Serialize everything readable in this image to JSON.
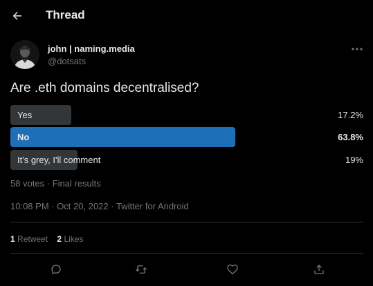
{
  "header": {
    "title": "Thread",
    "back_icon": "arrow-left-icon"
  },
  "tweet": {
    "author": {
      "name": "john | naming.media",
      "handle": "@dotsats"
    },
    "more_icon": "more-horizontal-icon",
    "text": "Are .eth domains decentralised?",
    "poll": {
      "options": [
        {
          "label": "Yes",
          "percent": "17.2%",
          "fraction": 0.172,
          "winner": false
        },
        {
          "label": "No",
          "percent": "63.8%",
          "fraction": 0.638,
          "winner": true
        },
        {
          "label": "It's grey, I'll comment",
          "percent": "19%",
          "fraction": 0.19,
          "winner": false
        }
      ],
      "meta": "58 votes · Final results"
    },
    "timestamp": "10:08 PM · Oct 20, 2022 · Twitter for Android",
    "stats": {
      "retweets_count": "1",
      "retweets_label": "Retweet",
      "likes_count": "2",
      "likes_label": "Likes"
    },
    "actions": [
      "reply-icon",
      "retweet-icon",
      "like-icon",
      "share-icon"
    ]
  },
  "colors": {
    "background": "#000000",
    "text_primary": "#e7e9ea",
    "text_secondary": "#71767b",
    "poll_bar": "#333639",
    "poll_winner": "#1d6fb8",
    "divider": "#2f3336"
  }
}
